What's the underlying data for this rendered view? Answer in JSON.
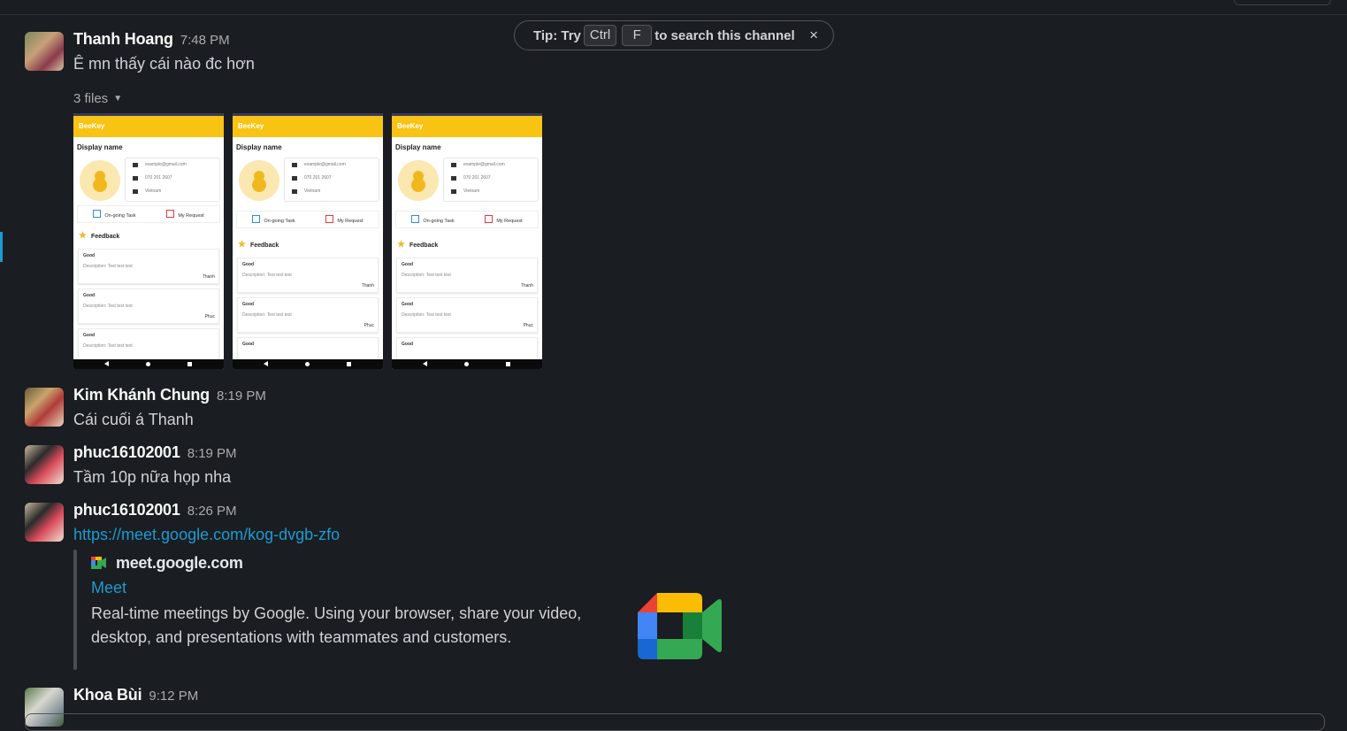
{
  "tip": {
    "prefix": "Tip: Try",
    "key1": "Ctrl",
    "key2": "F",
    "suffix": "to search this channel",
    "close": "×"
  },
  "messages": [
    {
      "author": "Thanh Hoang",
      "time": "7:48 PM",
      "text": "Ê mn thấy cái nào đc hơn"
    },
    {
      "author": "Kim Khánh Chung",
      "time": "8:19 PM",
      "text": "Cái cuối á Thanh"
    },
    {
      "author": "phuc16102001",
      "time": "8:19 PM",
      "text": "Tầm 10p nữa họp nha"
    },
    {
      "author": "phuc16102001",
      "time": "8:26 PM",
      "link": "https://meet.google.com/kog-dvgb-zfo"
    },
    {
      "author": "Khoa Bùi",
      "time": "9:12 PM"
    }
  ],
  "files": {
    "label": "3 files"
  },
  "screenshots": [
    {
      "app": "BeeKey",
      "display_name": "Display name",
      "email": "example@gmail.com",
      "phone": "070 201 2607",
      "location": "Vietnam",
      "tab1": "On-going Task",
      "tab2": "My Request",
      "feedback": "Feedback",
      "cards": [
        {
          "title": "Good",
          "desc": "Description: Test test test",
          "name": "Thanh"
        },
        {
          "title": "Good",
          "desc": "Description: Test test test",
          "name": "Phuc"
        },
        {
          "title": "Good",
          "desc": "Description: Test test test",
          "name": ""
        }
      ]
    },
    {
      "app": "BeeKey",
      "display_name": "Display name",
      "email": "example@gmail.com",
      "phone": "070 201 2607",
      "location": "Vietnam",
      "tab1": "On-going Task",
      "tab2": "My Request",
      "feedback": "Feedback",
      "cards": [
        {
          "title": "Good",
          "desc": "Description: Test test test",
          "name": "Thanh"
        },
        {
          "title": "Good",
          "desc": "Description: Test test test",
          "name": "Phuc"
        },
        {
          "title": "Good",
          "desc": "",
          "name": ""
        }
      ]
    },
    {
      "app": "BeeKey",
      "display_name": "Display name",
      "email": "example@gmail.com",
      "phone": "070 201 2607",
      "location": "Vietnam",
      "tab1": "On-going Task",
      "tab2": "My Request",
      "feedback": "Feedback",
      "cards": [
        {
          "title": "Good",
          "desc": "Description: Test test test",
          "name": "Thanh"
        },
        {
          "title": "Good",
          "desc": "Description: Test test test",
          "name": "Phuc"
        },
        {
          "title": "Good",
          "desc": "",
          "name": ""
        }
      ]
    }
  ],
  "unfurl": {
    "site": "meet.google.com",
    "title": "Meet",
    "description": "Real-time meetings by Google. Using your browser, share your video, desktop, and presentations with teammates and customers."
  },
  "colors": {
    "background": "#1a1d21",
    "link": "#1d9bd1",
    "app_bar": "#f8c313"
  }
}
